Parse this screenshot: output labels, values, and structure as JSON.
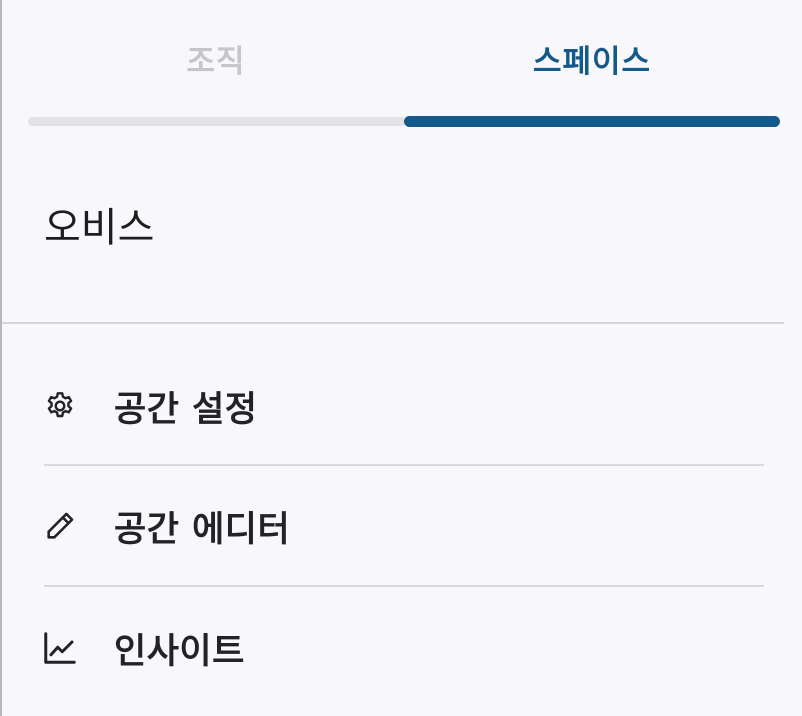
{
  "tabs": [
    {
      "label": "조직",
      "active": false
    },
    {
      "label": "스페이스",
      "active": true
    }
  ],
  "space": {
    "name": "오비스"
  },
  "menu": [
    {
      "label": "공간 설정",
      "icon": "gear-icon"
    },
    {
      "label": "공간 에디터",
      "icon": "pencil-icon"
    },
    {
      "label": "인사이트",
      "icon": "line-chart-icon"
    }
  ],
  "colors": {
    "accent": "#135a8a",
    "inactive_tab": "#c6c6c9",
    "background": "#f8f8fa",
    "text": "#1d1d20"
  }
}
